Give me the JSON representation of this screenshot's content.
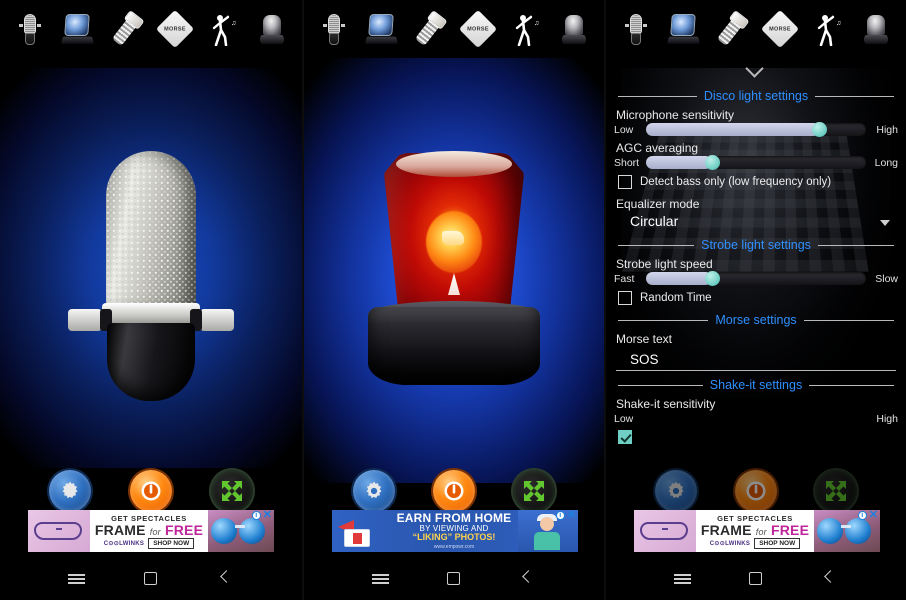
{
  "app": {
    "toolbar": {
      "items": [
        {
          "name": "microphone",
          "icon": "microphone-icon",
          "label": "Microphone"
        },
        {
          "name": "disco",
          "icon": "disco-light-icon",
          "label": "Disco light"
        },
        {
          "name": "flashlight",
          "icon": "flashlight-icon",
          "label": "Flashlight"
        },
        {
          "name": "morse",
          "icon": "morse-diamond-icon",
          "label": "MORSE"
        },
        {
          "name": "shake",
          "icon": "dancing-person-icon",
          "label": "Shake it"
        },
        {
          "name": "beacon",
          "icon": "police-beacon-icon",
          "label": "Police light"
        }
      ]
    },
    "controls": [
      {
        "name": "settings",
        "icon": "gear-icon",
        "color": "#2f6fc0"
      },
      {
        "name": "power",
        "icon": "power-icon",
        "color": "#ff8a12"
      },
      {
        "name": "expand",
        "icon": "expand-arrows-icon",
        "color": "#5fbf3f"
      }
    ],
    "navbar": [
      {
        "name": "recents",
        "icon": "hamburger-icon"
      },
      {
        "name": "home",
        "icon": "square-icon"
      },
      {
        "name": "back",
        "icon": "chevron-left-icon"
      }
    ]
  },
  "panels": [
    {
      "id": "microphone-screen",
      "hero": "vintage-condenser-microphone",
      "glow": "#1c4ec8"
    },
    {
      "id": "police-beacon-screen",
      "hero": "red-rotating-beacon",
      "glow": "#2a63ef"
    },
    {
      "id": "settings-screen",
      "hero": "settings-overlay",
      "glow": "#000000"
    }
  ],
  "ads": {
    "spectacles": {
      "line1": "GET SPECTACLES",
      "line2_a": "FRAME",
      "line2_em": "for",
      "line2_b": "FREE",
      "brand": "C⊙⊙LWINKS",
      "cta": "SHOP NOW",
      "info": "i",
      "close": "✕"
    },
    "earn": {
      "line1": "EARN FROM HOME",
      "line2": "BY VIEWING AND",
      "line3_quote": "“LIKING”",
      "line3_rest": " PHOTOS!",
      "url": "www.empowr.com",
      "info": "i",
      "close": "✕"
    }
  },
  "settings": {
    "collapse_chevron": "chevron-down-icon",
    "sections": {
      "disco": {
        "title": "Disco light settings",
        "mic_sensitivity": {
          "label": "Microphone sensitivity",
          "low": "Low",
          "high": "High",
          "value": 79
        },
        "agc": {
          "label": "AGC averaging",
          "short": "Short",
          "long": "Long",
          "value": 30
        },
        "bass_only": {
          "label": "Detect bass only (low frequency only)",
          "checked": false
        },
        "equalizer": {
          "label": "Equalizer mode",
          "value": "Circular"
        }
      },
      "strobe": {
        "title": "Strobe light settings",
        "speed": {
          "label": "Strobe light speed",
          "fast": "Fast",
          "slow": "Slow",
          "value": 30
        },
        "random_time": {
          "label": "Random Time",
          "checked": false
        }
      },
      "morse": {
        "title": "Morse settings",
        "text_label": "Morse text",
        "text_value": "SOS"
      },
      "shake": {
        "title": "Shake-it settings",
        "sensitivity": {
          "label": "Shake-it sensitivity",
          "low": "Low",
          "high": "High"
        },
        "enabled": {
          "checked": true
        }
      }
    }
  }
}
